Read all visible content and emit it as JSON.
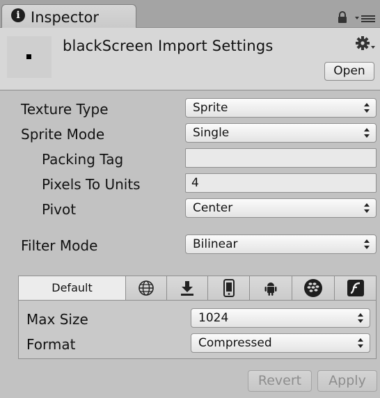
{
  "window": {
    "tab_title": "Inspector",
    "icons": [
      "info-icon",
      "lock-icon",
      "panel-menu-icon"
    ]
  },
  "header": {
    "title": "blackScreen Import Settings",
    "open_label": "Open",
    "icons": [
      "texture-preview",
      "gear-menu-icon"
    ]
  },
  "properties": {
    "texture_type": {
      "label": "Texture Type",
      "value": "Sprite"
    },
    "sprite_mode": {
      "label": "Sprite Mode",
      "value": "Single"
    },
    "packing_tag": {
      "label": "Packing Tag",
      "value": ""
    },
    "pixels_to_units": {
      "label": "Pixels To Units",
      "value": "4"
    },
    "pivot": {
      "label": "Pivot",
      "value": "Center"
    },
    "filter_mode": {
      "label": "Filter Mode",
      "value": "Bilinear"
    }
  },
  "platform": {
    "tabs": [
      {
        "label": "Default",
        "icon": "default",
        "selected": true
      },
      {
        "label": "",
        "icon": "web-globe-icon"
      },
      {
        "label": "",
        "icon": "download-icon"
      },
      {
        "label": "",
        "icon": "phone-icon"
      },
      {
        "label": "",
        "icon": "android-icon"
      },
      {
        "label": "",
        "icon": "blackberry-icon"
      },
      {
        "label": "",
        "icon": "flash-icon"
      }
    ],
    "max_size": {
      "label": "Max Size",
      "value": "1024"
    },
    "format": {
      "label": "Format",
      "value": "Compressed"
    }
  },
  "footer": {
    "revert_label": "Revert",
    "apply_label": "Apply",
    "buttons_enabled": false
  },
  "colors": {
    "panel_bg": "#c2c2c2",
    "header_bg": "#d7d7d7",
    "tabstrip_bg": "#a4a4a4",
    "disabled_text": "#8d8d8d"
  }
}
